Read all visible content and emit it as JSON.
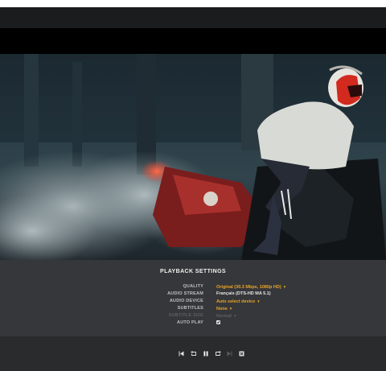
{
  "settings": {
    "title": "PLAYBACK SETTINGS",
    "rows": [
      {
        "label": "QUALITY",
        "value": "Original (30.3 Mbps, 1080p HD)"
      },
      {
        "label": "AUDIO STREAM",
        "value": "Français (DTS-HD MA 5.1)"
      },
      {
        "label": "AUDIO DEVICE",
        "value": "Auto select device"
      },
      {
        "label": "SUBTITLES",
        "value": "None"
      },
      {
        "label": "SUBTITLE SIZE",
        "value": "Normal"
      },
      {
        "label": "AUTO PLAY",
        "checked": true
      }
    ]
  },
  "controls": [
    "skip-previous-icon",
    "replay-icon",
    "pause-icon",
    "forward-icon",
    "skip-next-icon",
    "stop-icon"
  ],
  "colors": {
    "accent": "#e7a428",
    "panel": "#303134",
    "control_bar": "#2a2b2d"
  }
}
